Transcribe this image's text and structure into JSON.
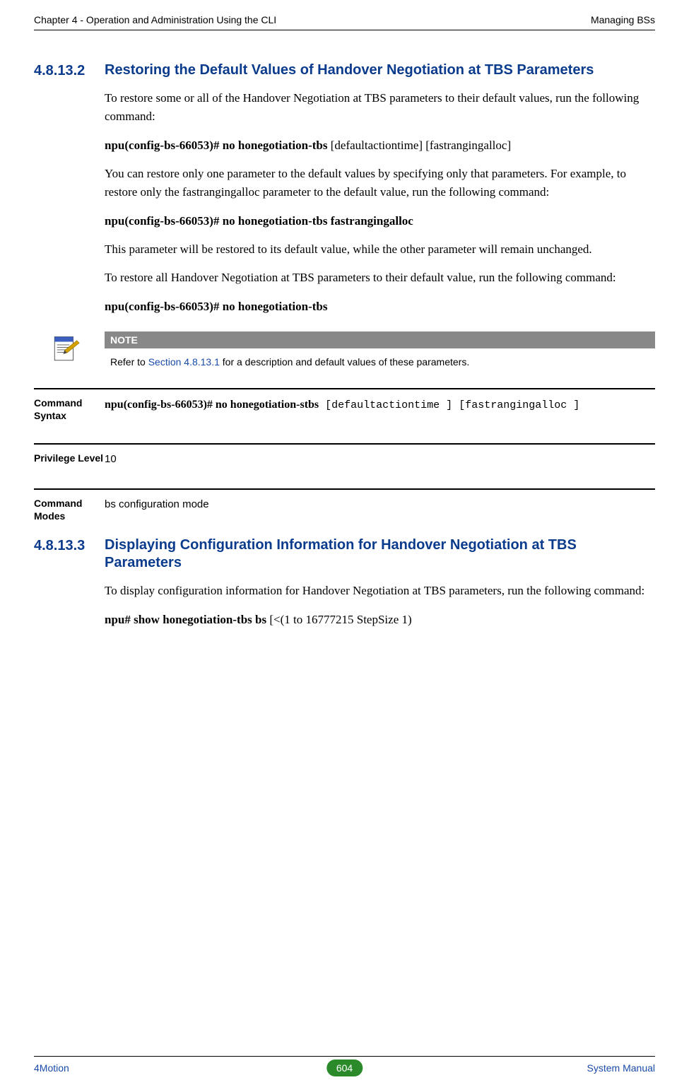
{
  "header": {
    "left": "Chapter 4 - Operation and Administration Using the CLI",
    "right": "Managing BSs"
  },
  "sections": {
    "s1": {
      "num": "4.8.13.2",
      "title": "Restoring the Default Values of Handover Negotiation at TBS Parameters",
      "p1": "To restore some or all of the Handover Negotiation at TBS parameters to their default values, run the following command:",
      "p2a": "npu(config-bs-66053)# no honegotiation-tbs",
      "p2b": " [defaultactiontime] [fastrangingalloc]",
      "p3": "You can restore only one parameter to the default values by specifying only that parameters. For example, to restore only the fastrangingalloc parameter to the default value, run the following command:",
      "p4": "npu(config-bs-66053)# no honegotiation-tbs fastrangingalloc",
      "p5": "This parameter will be restored to its default value, while the other parameter will remain unchanged.",
      "p6": "To restore all Handover Negotiation at TBS parameters to their default value, run the following command:",
      "p7": "npu(config-bs-66053)# no honegotiation-tbs"
    },
    "note": {
      "header": "NOTE",
      "text_a": "Refer to ",
      "link": "Section 4.8.13.1",
      "text_b": " for a description and default values of these parameters."
    },
    "rows": {
      "r1_label": "Command Syntax",
      "r1_cmd": "npu(config-bs-66053)# no honegotiation-stbs",
      "r1_args": " [defaultactiontime ] [fastrangingalloc ]",
      "r2_label": "Privilege Level",
      "r2_val": "10",
      "r3_label": "Command Modes",
      "r3_val": "bs configuration mode"
    },
    "s2": {
      "num": "4.8.13.3",
      "title": "Displaying Configuration Information for Handover Negotiation at TBS Parameters",
      "p1": "To display configuration information for Handover Negotiation at TBS parameters, run the following command:",
      "p2a": "npu# show honegotiation-tbs bs",
      "p2b": " [<(1 to 16777215 StepSize 1)"
    }
  },
  "footer": {
    "left": "4Motion",
    "page": "604",
    "right": "System Manual"
  }
}
